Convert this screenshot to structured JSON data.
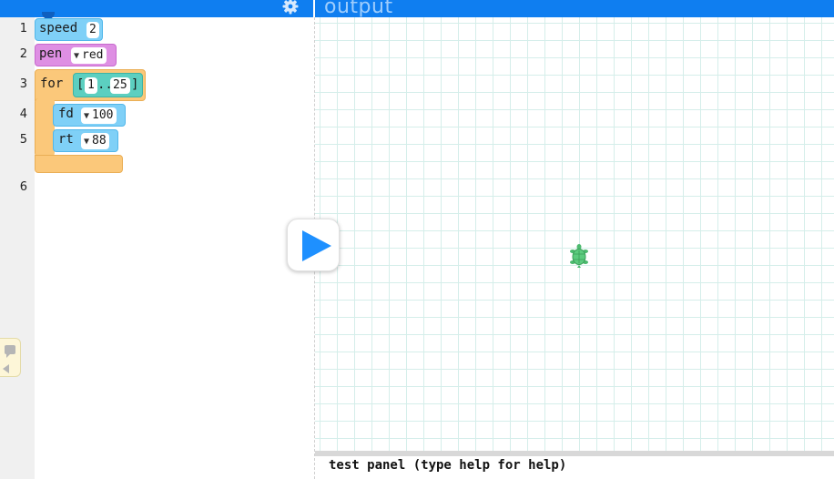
{
  "output": {
    "title": "output"
  },
  "editor": {
    "line_numbers": [
      "1",
      "2",
      "3",
      "4",
      "5",
      "6"
    ],
    "blocks": {
      "speed": {
        "keyword": "speed",
        "value": "2"
      },
      "pen": {
        "keyword": "pen",
        "value": "red"
      },
      "for": {
        "keyword": "for",
        "range_open": "[",
        "range_start": "1",
        "range_sep": "..",
        "range_end": "25",
        "range_close": "]"
      },
      "fd": {
        "keyword": "fd",
        "value": "100"
      },
      "rt": {
        "keyword": "rt",
        "value": "88"
      }
    }
  },
  "test_panel": {
    "text": "test panel (type help for help)"
  },
  "colors": {
    "topbar": "#0f7ef0",
    "motion_block": "#7fd0f7",
    "pen_block": "#de8fe3",
    "control_block": "#fbc87a",
    "range_block": "#5ccfc0",
    "grid_line": "#d5eeea",
    "turtle": "#4cba6e"
  },
  "icons": {
    "settings": "gear-icon",
    "run": "play-icon",
    "turtle": "turtle-icon",
    "palette": "comment-icon"
  }
}
